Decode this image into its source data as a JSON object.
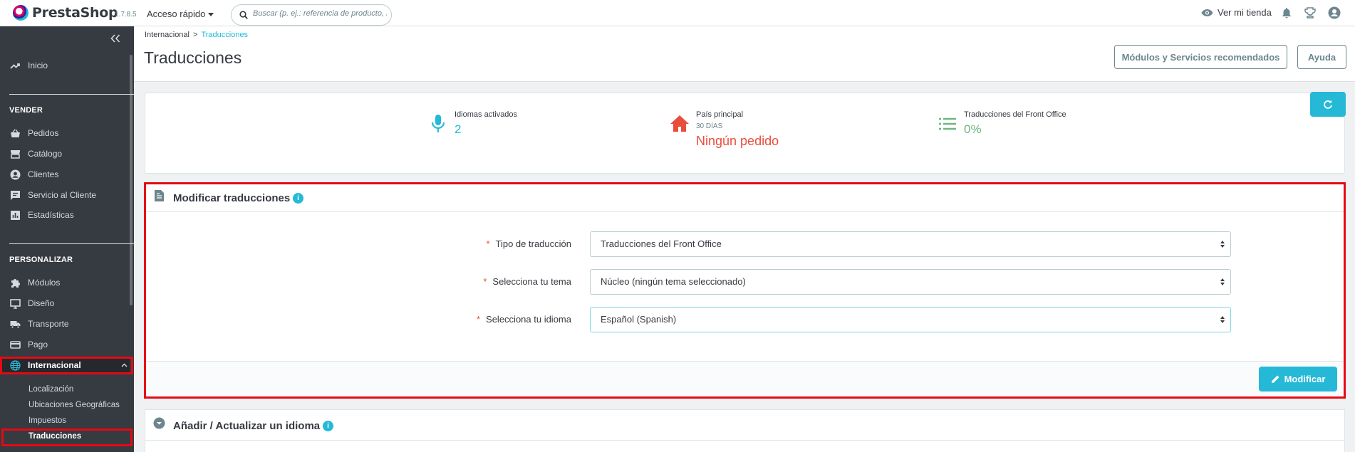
{
  "header": {
    "brand": "PrestaShop",
    "version": "1.7.8.5",
    "quick_access": "Acceso rápido",
    "search_placeholder": "Buscar (p. ej.: referencia de producto, n",
    "view_shop": "Ver mi tienda"
  },
  "sidebar": {
    "home": "Inicio",
    "section_sell": "VENDER",
    "sell_items": [
      "Pedidos",
      "Catálogo",
      "Clientes",
      "Servicio al Cliente",
      "Estadísticas"
    ],
    "section_customize": "PERSONALIZAR",
    "customize_items": [
      "Módulos",
      "Diseño",
      "Transporte",
      "Pago",
      "Internacional"
    ],
    "sub_items": [
      "Localización",
      "Ubicaciones Geográficas",
      "Impuestos",
      "Traducciones"
    ],
    "active_item": "Internacional",
    "active_sub_item": "Traducciones"
  },
  "breadcrumb": {
    "parent": "Internacional",
    "sep": ">",
    "current": "Traducciones"
  },
  "page_title": "Traducciones",
  "toolbar": {
    "modules_button": "Módulos y Servicios recomendados",
    "help_button": "Ayuda"
  },
  "kpis": [
    {
      "label": "Idiomas activados",
      "sub": "",
      "value": "2",
      "color": "#25b9d7"
    },
    {
      "label": "País principal",
      "sub": "30 DÍAS",
      "value": "Ningún pedido",
      "color": "#e94d3d"
    },
    {
      "label": "Traducciones del Front Office",
      "sub": "",
      "value": "0%",
      "color": "#70b580"
    }
  ],
  "modify_panel": {
    "title": "Modificar traducciones",
    "fields": [
      {
        "label": "Tipo de traducción",
        "value": "Traducciones del Front Office"
      },
      {
        "label": "Selecciona tu tema",
        "value": "Núcleo (ningún tema seleccionado)"
      },
      {
        "label": "Selecciona tu idioma",
        "value": "Español (Spanish)"
      }
    ],
    "required_mark": "*",
    "submit": "Modificar"
  },
  "add_panel": {
    "title": "Añadir / Actualizar un idioma"
  },
  "colors": {
    "accent": "#25b9d7",
    "sidebar": "#363a41",
    "highlight": "#e50914"
  }
}
